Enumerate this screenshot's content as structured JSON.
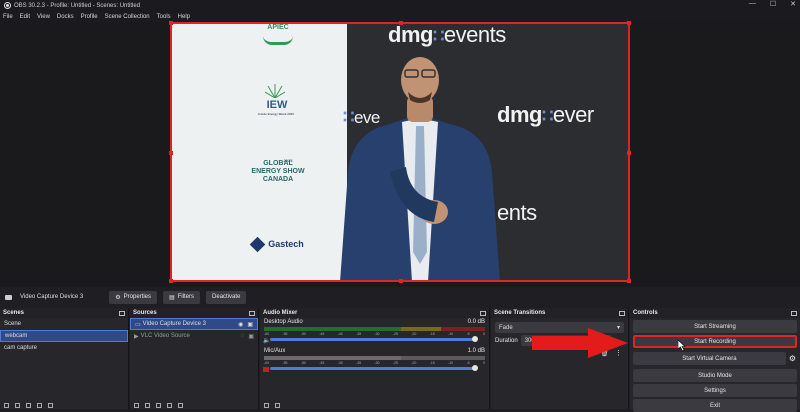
{
  "window": {
    "title": "OBS 30.2.3 - Profile: Untitled - Scenes: Untitled",
    "min": "—",
    "max": "☐",
    "close": "✕"
  },
  "menu": [
    "File",
    "Edit",
    "View",
    "Docks",
    "Profile",
    "Scene Collection",
    "Tools",
    "Help"
  ],
  "preview": {
    "dmg_1": {
      "a": "dmg",
      "b": "events"
    },
    "dmg_2": {
      "a": "dmg",
      "b": "ever"
    },
    "dmg_3": {
      "a": "eve"
    },
    "dmg_4": {
      "a": "ents"
    },
    "sponsors": [
      "APIEC",
      "IEW",
      "GLOBAL ENERGY SHOW CANADA",
      "Gastech"
    ],
    "sponsor_small": {
      "iew": "Inside Energy Week 2025",
      "ges": "2025"
    }
  },
  "source_toolbar": {
    "source_name": "Video Capture Device 3",
    "properties": "Properties",
    "filters": "Filters",
    "deactivate": "Deactivate"
  },
  "scenes": {
    "title": "Scenes",
    "items": [
      "Scene",
      "webcam",
      "cam capture"
    ],
    "selected": 1
  },
  "sources": {
    "title": "Sources",
    "items": [
      "Video Capture Device 3",
      "VLC Video Source"
    ]
  },
  "mixer": {
    "title": "Audio Mixer",
    "tracks": [
      {
        "name": "Desktop Audio",
        "db": "0.0 dB"
      },
      {
        "name": "Mic/Aux",
        "db": "1.0 dB"
      }
    ],
    "ticks": [
      "-60",
      "-55",
      "-50",
      "-45",
      "-40",
      "-35",
      "-30",
      "-25",
      "-20",
      "-15",
      "-10",
      "-5",
      "0"
    ]
  },
  "transitions": {
    "title": "Scene Transitions",
    "type": "Fade",
    "duration_label": "Duration",
    "duration": "300"
  },
  "controls": {
    "title": "Controls",
    "buttons": [
      "Start Streaming",
      "Start Recording",
      "Start Virtual Camera",
      "Studio Mode",
      "Settings",
      "Exit"
    ]
  },
  "colors": {
    "accent": "#4f7bd6",
    "highlight": "#e02424",
    "arrow": "#e31b1b"
  }
}
